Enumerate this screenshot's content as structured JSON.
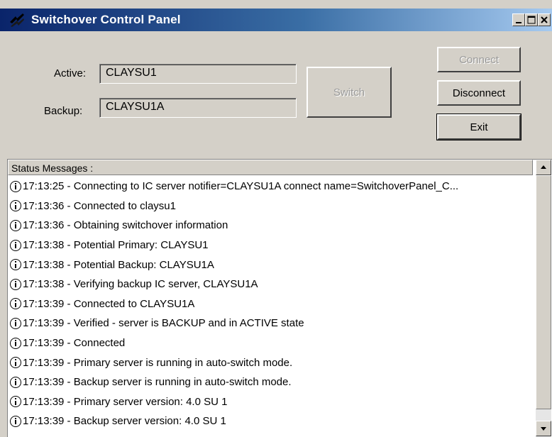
{
  "window": {
    "title": "Switchover Control Panel",
    "icon": "app-icon",
    "controls": [
      "minimize-icon",
      "maximize-icon",
      "close-icon"
    ]
  },
  "servers": {
    "active_label": "Active:",
    "active_value": "CLAYSU1",
    "backup_label": "Backup:",
    "backup_value": "CLAYSU1A"
  },
  "buttons": {
    "switch": "Switch",
    "connect": "Connect",
    "disconnect": "Disconnect",
    "exit": "Exit"
  },
  "status": {
    "header": "Status Messages :",
    "icon": "info-icon",
    "messages": [
      "17:13:25 - Connecting to IC server notifier=CLAYSU1A connect name=SwitchoverPanel_C...",
      "17:13:36 - Connected to claysu1",
      "17:13:36 - Obtaining switchover information",
      "17:13:38 - Potential Primary:  CLAYSU1",
      "17:13:38 - Potential Backup:  CLAYSU1A",
      "17:13:38 - Verifying backup IC server, CLAYSU1A",
      "17:13:39 - Connected to CLAYSU1A",
      "17:13:39 - Verified - server is BACKUP and in ACTIVE state",
      "17:13:39 - Connected",
      "17:13:39 - Primary server is running in auto-switch mode.",
      "17:13:39 - Backup server is running in auto-switch mode.",
      "17:13:39 - Primary server version: 4.0 SU 1",
      "17:13:39 - Backup server version: 4.0 SU 1"
    ]
  },
  "colors": {
    "titlebar_start": "#0a246a",
    "titlebar_end": "#a6caf0",
    "face": "#d4d0c8"
  }
}
